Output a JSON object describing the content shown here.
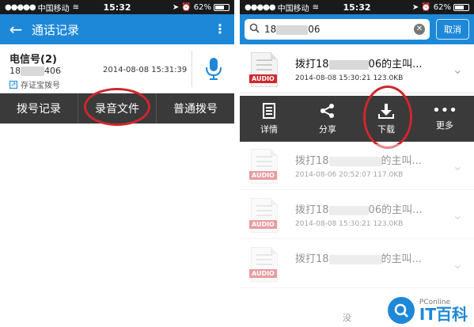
{
  "left": {
    "status": {
      "carrier": "中国移动",
      "time": "15:32",
      "battery": "62%",
      "battery_level": 0.62
    },
    "header": {
      "title": "通话记录"
    },
    "contact": {
      "name": "电信号(2)",
      "number": "18",
      "number_suffix": "406",
      "date": "2014-08-08 15:31:39",
      "tag": "存证宝拨号"
    },
    "options": {
      "items": [
        "拨号记录",
        "录音文件",
        "普通拨号"
      ]
    }
  },
  "right": {
    "status": {
      "carrier": "中国移动",
      "time": "15:32",
      "battery": "62%",
      "battery_level": 0.62
    },
    "search": {
      "value": "18",
      "value_suffix": "06",
      "cancel": "取消"
    },
    "records": [
      {
        "title_prefix": "拨打18",
        "title_suffix": "06的主叫...",
        "badge": "AUDIO",
        "meta": "2014-08-08 15:30:21  123.0KB"
      },
      {
        "title_prefix": "拨打18",
        "title_suffix": "的主叫...",
        "badge": "AUDIO",
        "meta": "2014-08-06 20:52:07  117.0KB"
      },
      {
        "title_prefix": "拨打18",
        "title_suffix": "06的主叫...",
        "badge": "AUDIO",
        "meta": "2014-08-08 15:30:21  123.0KB"
      },
      {
        "title_prefix": "拨打18",
        "title_suffix": "的主叫...",
        "badge": "AUDIO",
        "meta": ""
      }
    ],
    "actions": {
      "items": [
        "详情",
        "分享",
        "下载",
        "更多"
      ]
    },
    "footer": {
      "mei": "没"
    },
    "watermark": {
      "small": "PConline",
      "big": "IT百科"
    }
  },
  "colors": {
    "accent": "#1e88d8",
    "highlight": "#d0262e",
    "bar": "#3a3a3a"
  }
}
